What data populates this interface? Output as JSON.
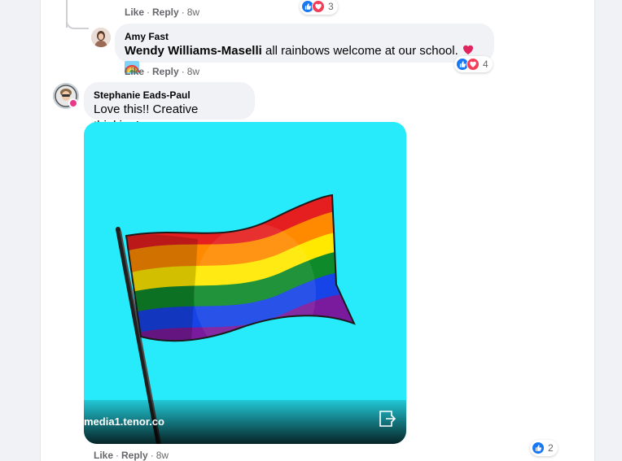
{
  "colors": {
    "page_bg": "#f0f2f5",
    "bubble_bg": "#f0f2f5",
    "meta_text": "#65676b",
    "like_blue": "#1877f2",
    "love_red": "#f33e58",
    "gif_bg": "#27ebfb"
  },
  "top_comment": {
    "actions": {
      "like": "Like",
      "reply": "Reply",
      "time": "8w"
    },
    "reactions": {
      "icons": [
        "like-icon",
        "love-icon"
      ],
      "count": "3"
    }
  },
  "reply_amy": {
    "author": "Amy Fast",
    "mention": "Wendy Williams-Maselli",
    "text": " all rainbows welcome at our school.",
    "emoji": [
      "red-heart",
      "rainbow"
    ],
    "actions": {
      "like": "Like",
      "reply": "Reply",
      "time": "8w"
    },
    "reactions": {
      "icons": [
        "like-icon",
        "love-icon"
      ],
      "count": "4"
    }
  },
  "comment_stephanie": {
    "author": "Stephanie Eads-Paul",
    "text": "Love this!! Creative thinking!",
    "gif": {
      "domain": "media1.tenor.co",
      "open_icon": "open-external-icon"
    },
    "actions": {
      "like": "Like",
      "reply": "Reply",
      "time": "8w"
    },
    "reactions": {
      "icons": [
        "like-icon"
      ],
      "count": "2"
    }
  }
}
